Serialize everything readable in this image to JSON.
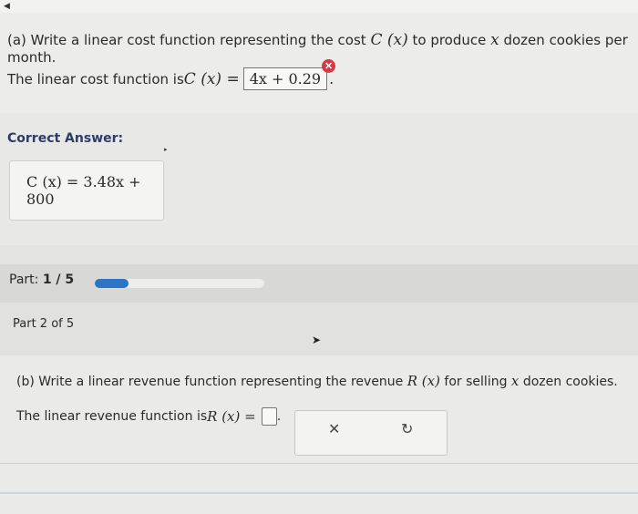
{
  "question_a": {
    "prefix": "(a) Write a linear cost function representing the cost ",
    "func": "C (x)",
    "middle": " to produce ",
    "var": "x",
    "suffix": " dozen cookies per month."
  },
  "answer_a": {
    "prefix": "The linear cost function is ",
    "func": "C (x) =",
    "value": "4x + 0.29",
    "period": "."
  },
  "correct": {
    "label": "Correct Answer:",
    "value": "C (x) = 3.48x + 800"
  },
  "progress": {
    "label_prefix": "Part: ",
    "label_value": "1 / 5",
    "fraction": 0.2
  },
  "part2": {
    "label": "Part 2 of 5"
  },
  "question_b": {
    "prefix": "(b) Write a linear revenue function representing the revenue ",
    "func": "R (x)",
    "middle": " for selling ",
    "var": "x",
    "suffix": " dozen cookies."
  },
  "answer_b": {
    "prefix": "The linear revenue function is ",
    "func": "R (x) =",
    "period": "."
  },
  "actions": {
    "clear": "✕",
    "undo": "↻"
  },
  "icons": {
    "error": "error-icon",
    "clear": "clear-icon",
    "undo": "undo-icon"
  },
  "colors": {
    "accent": "#2b74c6",
    "error": "#d53a42",
    "correct_label": "#2c3d6b"
  }
}
